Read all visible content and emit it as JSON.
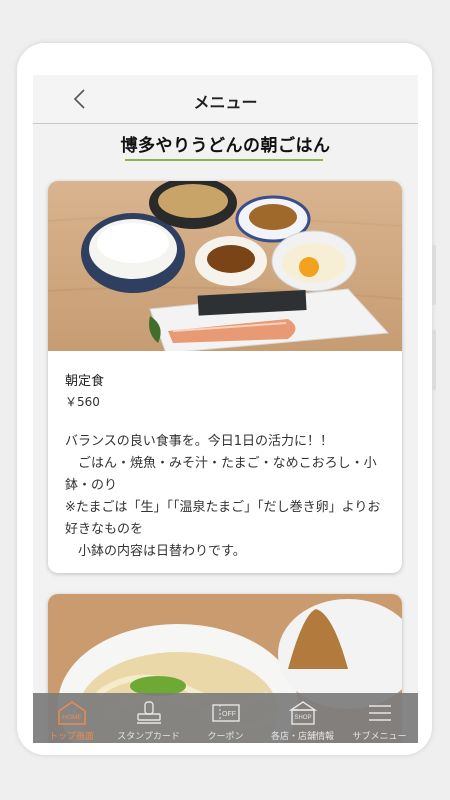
{
  "header": {
    "title": "メニュー"
  },
  "section": {
    "title": "博多やりうどんの朝ごはん"
  },
  "menu_items": [
    {
      "name": "朝定食",
      "price": "￥560",
      "description": "バランスの良い食事を。今日1日の活力に！！\n　ごはん・焼魚・みそ汁・たまご・なめこおろし・小鉢・のり\n※たまごは「生」「「温泉たまご」「だし巻き卵」よりお好きなものを\n　小鉢の内容は日替わりです。"
    }
  ],
  "tabbar": {
    "items": [
      {
        "label": "トップ画面",
        "icon": "home-icon",
        "icon_text": "HOME",
        "active": true
      },
      {
        "label": "スタンプカード",
        "icon": "stamp-icon"
      },
      {
        "label": "クーポン",
        "icon": "coupon-icon",
        "icon_text": "OFF"
      },
      {
        "label": "各店・店舗情報",
        "icon": "shop-icon",
        "icon_text": "SHOP"
      },
      {
        "label": "サブメニュー",
        "icon": "menu-icon"
      }
    ]
  },
  "colors": {
    "accent": "#f08a4b",
    "underline": "#8fb04a",
    "tabbar": "#7d7d7d"
  }
}
